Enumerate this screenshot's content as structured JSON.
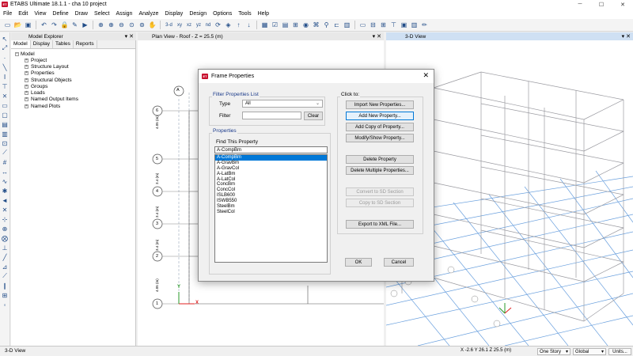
{
  "app": {
    "title": "ETABS Ultimate 18.1.1 - cha 10 project",
    "logo": "ET",
    "window_controls": [
      "minimize-icon",
      "maximize-icon",
      "close-icon"
    ]
  },
  "menu": [
    "File",
    "Edit",
    "View",
    "Define",
    "Draw",
    "Select",
    "Assign",
    "Analyze",
    "Display",
    "Design",
    "Options",
    "Tools",
    "Help"
  ],
  "toolbar_icons": [
    "new-icon",
    "open-icon",
    "save-icon",
    "undo-icon",
    "redo-icon",
    "lock-icon",
    "pencil-icon",
    "run-icon",
    "zoom-window-icon",
    "zoom-in-icon",
    "zoom-out-icon",
    "zoom-fit-icon",
    "zoom-prev-icon",
    "pan-icon",
    "3d-icon",
    "plan-icon",
    "elevation-icon",
    "rotate-icon",
    "perspective-icon",
    "up-icon",
    "down-icon",
    "object-shrink-icon",
    "display-options-icon",
    "set-display-icon",
    "show-undeformed-icon",
    "show-loads-icon",
    "show-deformed-icon",
    "show-forces-icon",
    "show-stress-icon",
    "design-icon"
  ],
  "toolbar_text": {
    "3d": "3-d",
    "xy": "xy",
    "xz": "xz",
    "yz": "yz",
    "nd": "nd"
  },
  "model_explorer": {
    "title": "Model Explorer",
    "tabs": [
      "Model",
      "Display",
      "Tables",
      "Reports"
    ],
    "root": "Model",
    "items": [
      "Project",
      "Structure Layout",
      "Properties",
      "Structural Objects",
      "Groups",
      "Loads",
      "Named Output Items",
      "Named Plots"
    ]
  },
  "plan_view": {
    "title": "Plan View - Roof - Z = 25.5 (m)",
    "grid_letters": [
      "A"
    ],
    "grid_numbers": [
      "6",
      "5",
      "4",
      "3",
      "2",
      "1"
    ],
    "dim_labels": [
      "4.05 (m)",
      "3.4 (m)",
      "3.4 (m)",
      "3.4 (m)",
      "4.05 (m)"
    ],
    "axis_x": "X",
    "axis_y": "Y"
  },
  "view_3d": {
    "title": "3-D View"
  },
  "dialog": {
    "title": "Frame Properties",
    "filter_group": "Filter Properties List",
    "type_label": "Type",
    "type_value": "All",
    "filter_label": "Filter",
    "filter_value": "",
    "clear_button": "Clear",
    "properties_group": "Properties",
    "find_label": "Find This Property",
    "find_value": "A-CompBm",
    "list": [
      "A-CompBm",
      "A-GravBm",
      "A-GravCol",
      "A-LatBm",
      "A-LatCol",
      "ConcBm",
      "ConcCol",
      "ISLB600",
      "ISWB550",
      "SteelBm",
      "SteelCol"
    ],
    "selected": "A-CompBm",
    "click_to_label": "Click to:",
    "buttons": {
      "import": "Import New Properties...",
      "add": "Add New Property...",
      "add_copy": "Add Copy of Property...",
      "modify": "Modify/Show Property...",
      "delete": "Delete Property",
      "delete_multiple": "Delete Multiple Properties...",
      "convert": "Convert to SD Section",
      "copy_sd": "Copy to SD Section",
      "export_xml": "Export to XML File...",
      "ok": "OK",
      "cancel": "Cancel"
    }
  },
  "status": {
    "left": "3-D View",
    "coords": "X -2.6  Y 26.1  Z 25.5 (m)",
    "story": "One Story",
    "coord_system": "Global",
    "units": "Units..."
  },
  "colors": {
    "accent": "#0078d7",
    "brand": "#c8102e",
    "axis_x": "#e02020",
    "axis_y": "#2a9a2a"
  }
}
